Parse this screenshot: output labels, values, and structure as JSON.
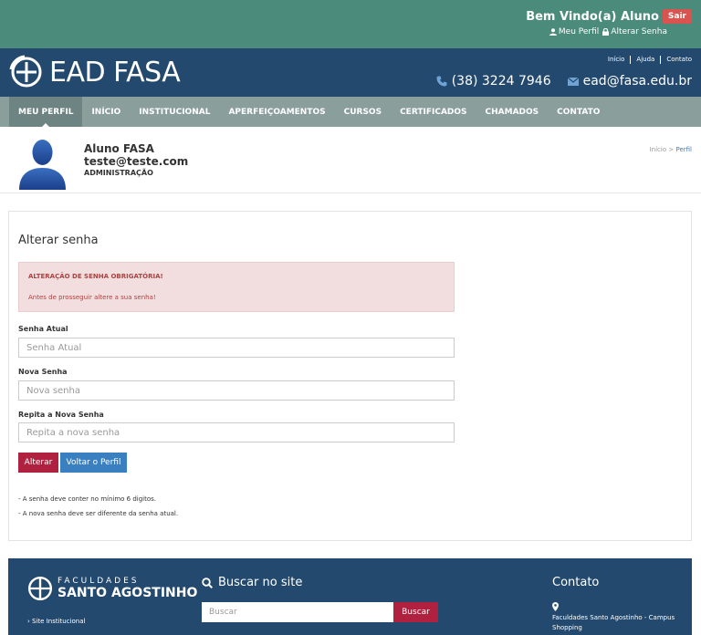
{
  "topbar": {
    "welcome": "Bem Vindo(a) Aluno",
    "logout": "Sair",
    "profile_link": "Meu Perfil",
    "password_link": "Alterar Senha"
  },
  "header": {
    "logo_text": "EAD FASA",
    "util_links": [
      "Início",
      "Ajuda",
      "Contato"
    ],
    "phone": "(38) 3224 7946",
    "email": "ead@fasa.edu.br"
  },
  "nav": {
    "items": [
      "MEU PERFIL",
      "INÍCIO",
      "INSTITUCIONAL",
      "APERFEIÇOAMENTOS",
      "CURSOS",
      "CERTIFICADOS",
      "CHAMADOS",
      "CONTATO"
    ]
  },
  "profile": {
    "name": "Aluno FASA",
    "email": "teste@teste.com",
    "role": "ADMINISTRAÇÃO",
    "breadcrumb_home": "Início",
    "breadcrumb_sep": ">",
    "breadcrumb_current": "Perfil"
  },
  "form": {
    "title": "Alterar senha",
    "alert_title": "ALTERAÇÃO DE SENHA OBRIGATÓRIA!",
    "alert_text": "Antes de prosseguir altere a sua senha!",
    "current_label": "Senha Atual",
    "current_placeholder": "Senha Atual",
    "new_label": "Nova Senha",
    "new_placeholder": "Nova senha",
    "repeat_label": "Repita a Nova Senha",
    "repeat_placeholder": "Repita a nova senha",
    "submit": "Alterar",
    "back": "Voltar o Perfil",
    "note1": "- A senha deve conter no mínimo 6 digitos.",
    "note2": "- A nova senha deve ser diferente da senha atual."
  },
  "footer": {
    "logo_line1": "FACULDADES",
    "logo_line2": "SANTO AGOSTINHO",
    "link1": "Site Institucional",
    "search_title": "Buscar no site",
    "search_placeholder": "Buscar",
    "search_button": "Buscar",
    "contact_title": "Contato",
    "address": "Faculdades Santo Agostinho - Campus Shopping"
  },
  "colors": {
    "topbar": "#4a8b7c",
    "header": "#234a6e",
    "nav": "#8a9e9c",
    "danger": "#b0213f",
    "primary": "#3a80c1"
  }
}
